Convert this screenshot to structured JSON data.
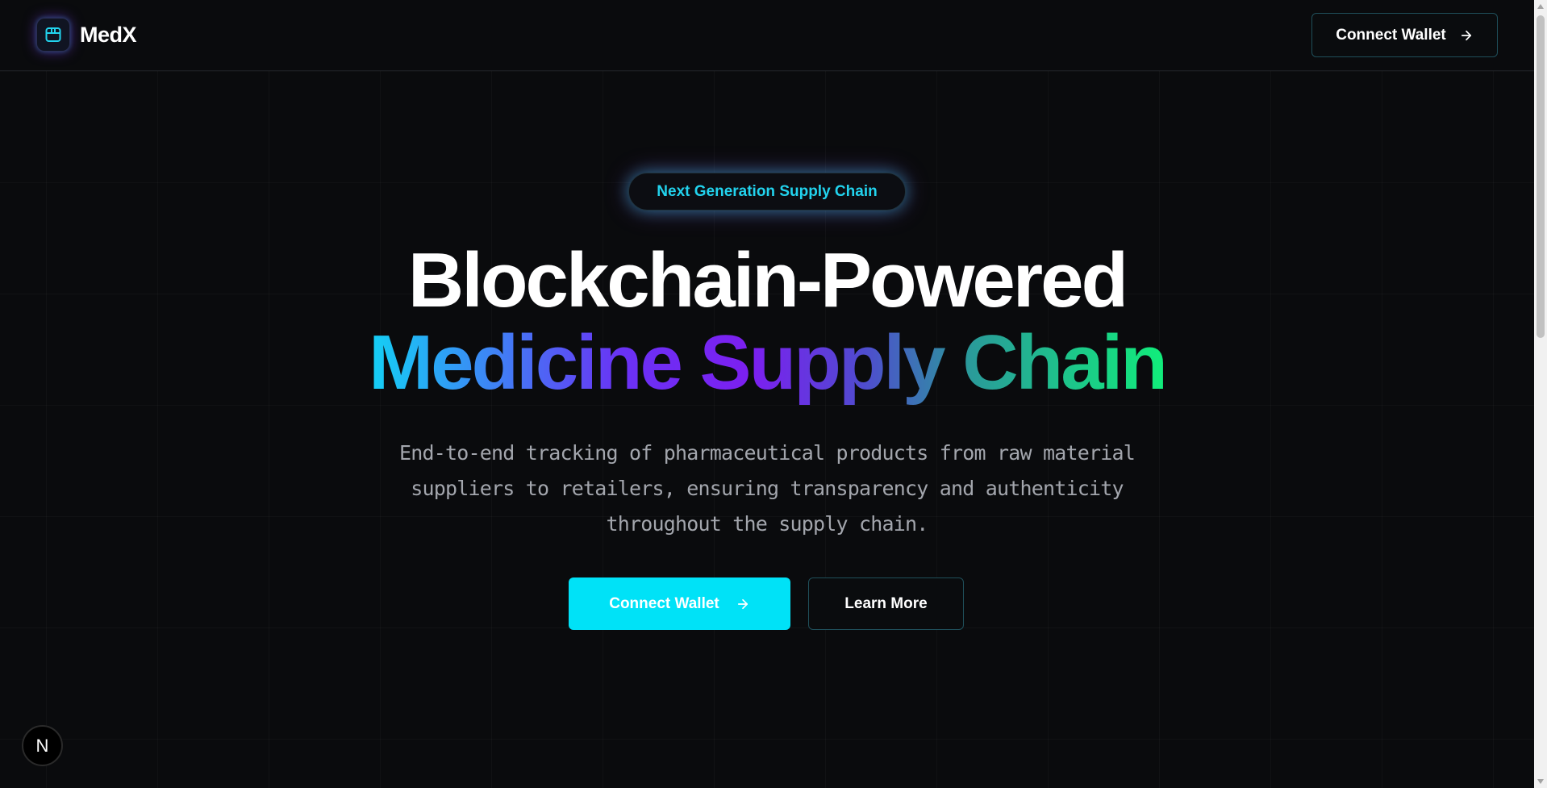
{
  "brand": {
    "name": "MedX",
    "icon": "package-icon",
    "accent": "#22d3ee"
  },
  "header": {
    "connect_label": "Connect Wallet",
    "connect_icon": "arrow-right-icon"
  },
  "hero": {
    "badge": "Next Generation Supply Chain",
    "headline_line1": "Blockchain-Powered",
    "headline_line2": "Medicine Supply Chain",
    "subtitle": "End-to-end tracking of pharmaceutical products from raw material suppliers to retailers, ensuring transparency and authenticity throughout the supply chain.",
    "primary_label": "Connect Wallet",
    "primary_icon": "arrow-right-icon",
    "secondary_label": "Learn More"
  },
  "dev_indicator": {
    "label": "N",
    "icon": "nextjs-icon"
  },
  "colors": {
    "background": "#0a0b0d",
    "primary_button": "#00e2f7",
    "gradient": [
      "#12d4f5",
      "#7c1ff0",
      "#10f07a"
    ]
  }
}
